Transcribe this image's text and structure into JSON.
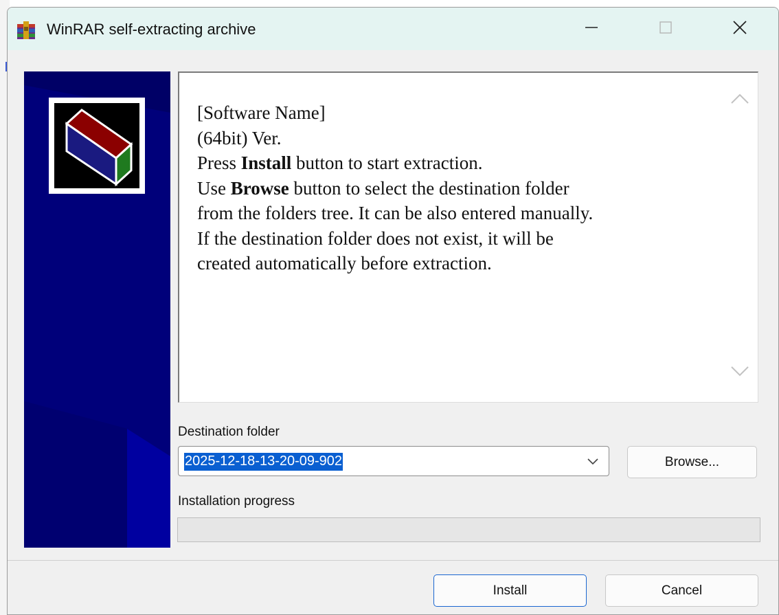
{
  "window": {
    "title": "WinRAR self-extracting archive"
  },
  "titlebar_icons": {
    "app": "winrar-icon",
    "minimize": "minimize-icon",
    "maximize": "maximize-icon",
    "close": "close-icon"
  },
  "info": {
    "line1": "[Software Name]",
    "line2": "(64bit) Ver.",
    "line3_pre": "Press ",
    "line3_bold": "Install",
    "line3_post": " button to start extraction.",
    "line4_pre": "Use ",
    "line4_bold": "Browse",
    "line4_post": " button to select the destination folder",
    "line5": "from the folders tree. It can be also entered manually.",
    "line6": "If the destination folder does not exist, it will be",
    "line7": "created automatically before extraction."
  },
  "destination": {
    "label": "Destination folder",
    "value": "2025-12-18-13-20-09-902"
  },
  "buttons": {
    "browse": "Browse...",
    "install": "Install",
    "cancel": "Cancel"
  },
  "progress": {
    "label": "Installation progress",
    "value_percent": 0
  },
  "colors": {
    "titlebar": "#e4f4f2",
    "side_panel": "#000066",
    "selection": "#0a5fd1",
    "accent_border": "#1a66d0"
  }
}
